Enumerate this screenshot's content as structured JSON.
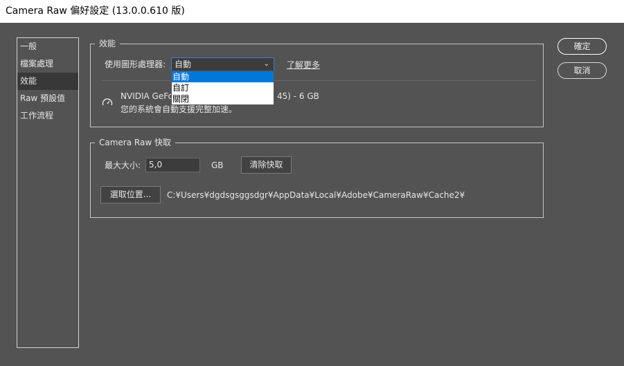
{
  "window": {
    "title": "Camera Raw 偏好設定 (13.0.0.610 版)"
  },
  "sidebar": {
    "items": [
      {
        "label": "一般"
      },
      {
        "label": "檔案處理"
      },
      {
        "label": "效能",
        "active": true
      },
      {
        "label": "Raw 預設值"
      },
      {
        "label": "工作流程"
      }
    ]
  },
  "performance": {
    "legend": "效能",
    "gpu_label": "使用圖形處理器:",
    "gpu_value": "自動",
    "learn_more": "了解更多",
    "dropdown_options": [
      "自動",
      "自訂",
      "關閉"
    ],
    "gpu_name_left": "NVIDIA GeFo",
    "gpu_name_right": "45) - 6 GB",
    "accel_text": "您的系統會自動支援完整加速。",
    "gauge_icon": "speedometer-icon"
  },
  "cache": {
    "legend": "Camera Raw 快取",
    "max_size_label": "最大大小:",
    "max_size_value": "5,0",
    "unit": "GB",
    "purge_label": "清除快取",
    "choose_location_label": "選取位置...",
    "path": "C:¥Users¥dgdsgsggsdgr¥AppData¥Local¥Adobe¥CameraRaw¥Cache2¥"
  },
  "buttons": {
    "ok": "確定",
    "cancel": "取消"
  },
  "colors": {
    "background": "#535353",
    "accent": "#0078d7",
    "field_focus": "#3c7fd6"
  }
}
